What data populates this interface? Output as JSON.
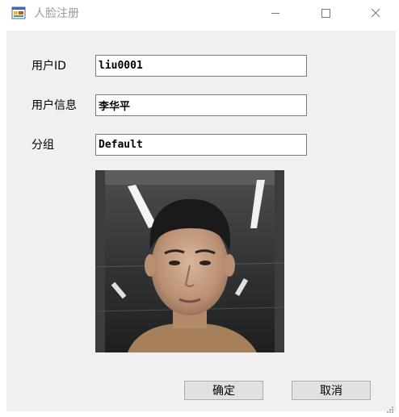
{
  "window": {
    "title": "人脸注册",
    "icon": "app-form-icon",
    "controls": [
      "minimize-icon",
      "maximize-icon",
      "close-icon"
    ]
  },
  "form": {
    "user_id_label": "用户ID",
    "user_id_value": "liu0001",
    "user_info_label": "用户信息",
    "user_info_value": "李华平",
    "group_label": "分组",
    "group_value": "Default"
  },
  "photo": {
    "description_icon": "face-photo"
  },
  "buttons": {
    "ok_label": "确定",
    "cancel_label": "取消"
  },
  "colors": {
    "client_bg": "#f0f0f0",
    "title_text": "#9a9a9a",
    "button_bg": "#e1e1e1",
    "button_border": "#adadad"
  }
}
